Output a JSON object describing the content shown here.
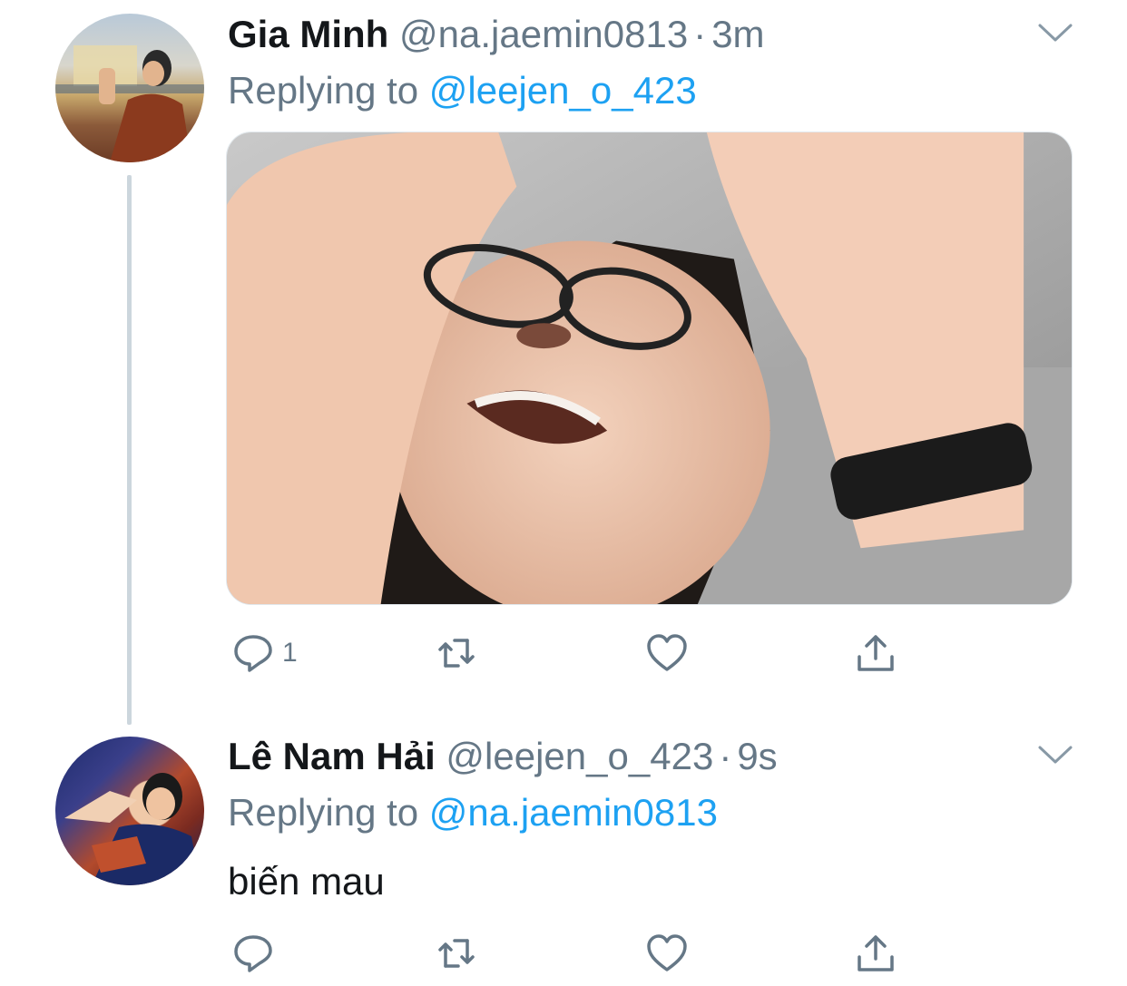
{
  "tweets": [
    {
      "name": "Gia Minh",
      "handle": "@na.jaemin0813",
      "separator": "·",
      "time": "3m",
      "replying_prefix": "Replying to",
      "replying_handle": "@leejen_o_423",
      "reply_count": "1",
      "has_media": true
    },
    {
      "name": "Lê Nam Hải",
      "handle": "@leejen_o_423",
      "separator": "·",
      "time": "9s",
      "replying_prefix": "Replying to",
      "replying_handle": "@na.jaemin0813",
      "text": "biến mau",
      "has_media": false
    }
  ],
  "colors": {
    "link": "#1da1f2",
    "secondary_text": "#657786",
    "primary_text": "#14171a",
    "thread_line": "#ccd6dd"
  },
  "icons": [
    "chevron-down-icon",
    "reply-icon",
    "retweet-icon",
    "like-icon",
    "share-icon"
  ]
}
